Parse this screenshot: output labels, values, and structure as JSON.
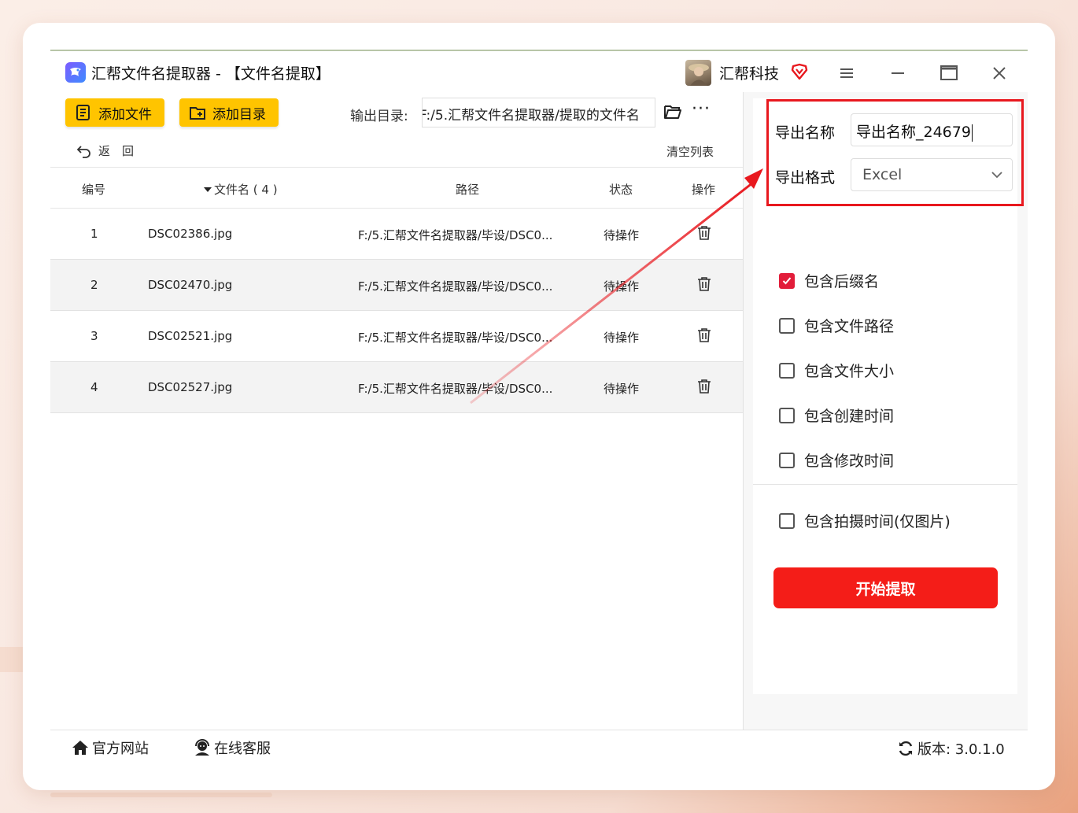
{
  "window": {
    "title": "汇帮文件名提取器 - 【文件名提取】",
    "brand": "汇帮科技"
  },
  "toolbar": {
    "add_file_label": "添加文件",
    "add_dir_label": "添加目录",
    "output_dir_label": "输出目录:",
    "output_dir_value": "F:/5.汇帮文件名提取器/提取的文件名",
    "more_label": "···",
    "back_label": "返　回",
    "clear_label": "清空列表"
  },
  "table": {
    "headers": {
      "index": "编号",
      "filename": "文件名 ( 4 )",
      "path": "路径",
      "status": "状态",
      "action": "操作"
    },
    "rows": [
      {
        "index": "1",
        "filename": "DSC02386.jpg",
        "path": "F:/5.汇帮文件名提取器/毕设/DSC0...",
        "status": "待操作"
      },
      {
        "index": "2",
        "filename": "DSC02470.jpg",
        "path": "F:/5.汇帮文件名提取器/毕设/DSC0...",
        "status": "待操作"
      },
      {
        "index": "3",
        "filename": "DSC02521.jpg",
        "path": "F:/5.汇帮文件名提取器/毕设/DSC0...",
        "status": "待操作"
      },
      {
        "index": "4",
        "filename": "DSC02527.jpg",
        "path": "F:/5.汇帮文件名提取器/毕设/DSC0...",
        "status": "待操作"
      }
    ]
  },
  "panel": {
    "export_name_label": "导出名称",
    "export_name_value": "导出名称_24679",
    "export_format_label": "导出格式",
    "export_format_value": "Excel",
    "options": [
      {
        "label": "包含后缀名",
        "checked": true
      },
      {
        "label": "包含文件路径",
        "checked": false
      },
      {
        "label": "包含文件大小",
        "checked": false
      },
      {
        "label": "包含创建时间",
        "checked": false
      },
      {
        "label": "包含修改时间",
        "checked": false
      },
      {
        "label": "包含拍摄时间(仅图片)",
        "checked": false
      }
    ],
    "start_label": "开始提取"
  },
  "footer": {
    "website_label": "官方网站",
    "support_label": "在线客服",
    "version_label": "版本: 3.0.1.0"
  },
  "colors": {
    "accent_yellow": "#ffc400",
    "start_red": "#f41d18",
    "highlight_red": "#e8181e",
    "check_red": "#e21d3a"
  }
}
